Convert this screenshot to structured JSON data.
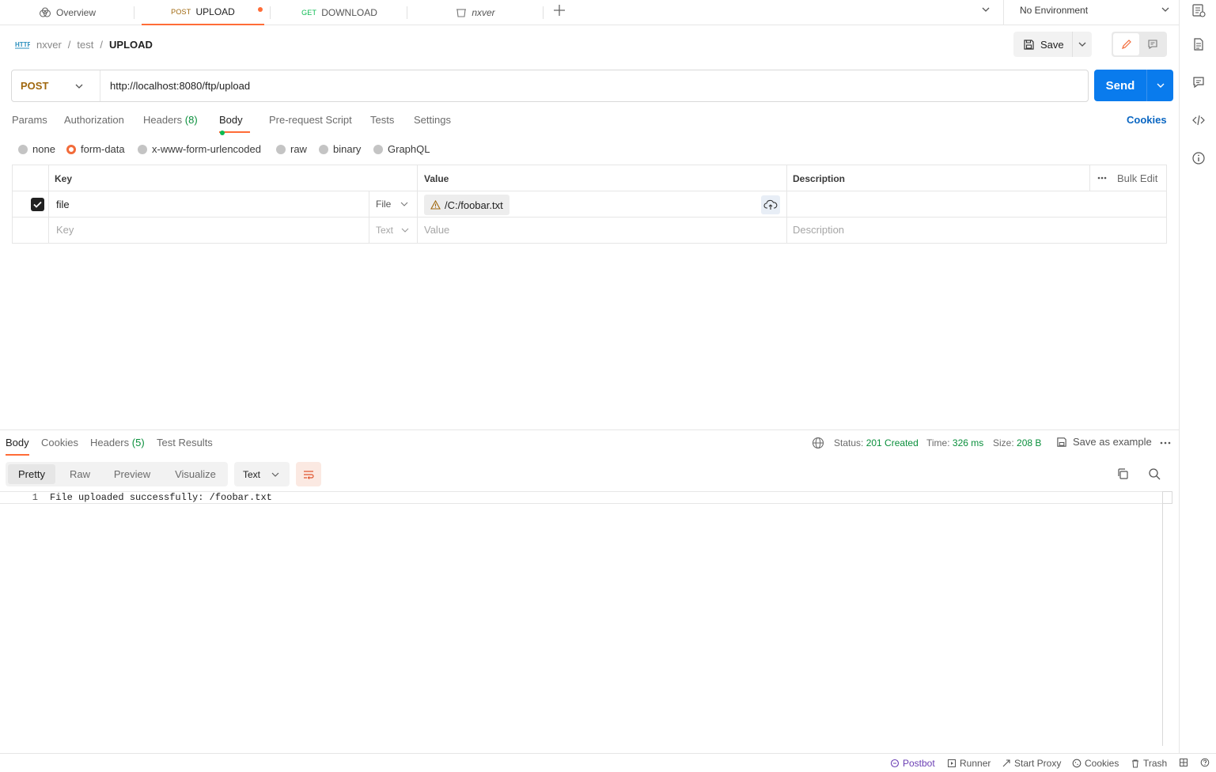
{
  "tabs": {
    "overview": "Overview",
    "upload_method": "POST",
    "upload_name": "UPLOAD",
    "download_method": "GET",
    "download_name": "DOWNLOAD",
    "collection_name": "nxver"
  },
  "environment": "No Environment",
  "breadcrumb": {
    "collection": "nxver",
    "folder": "test",
    "request": "UPLOAD",
    "sep": "/"
  },
  "toolbar": {
    "save_label": "Save"
  },
  "request": {
    "method": "POST",
    "url": "http://localhost:8080/ftp/upload",
    "send_label": "Send"
  },
  "request_tabs": {
    "params": "Params",
    "authorization": "Authorization",
    "headers": "Headers",
    "headers_count": "(8)",
    "body": "Body",
    "prerequest": "Pre-request Script",
    "tests": "Tests",
    "settings": "Settings",
    "cookies": "Cookies"
  },
  "body_types": {
    "none": "none",
    "form_data": "form-data",
    "urlencoded": "x-www-form-urlencoded",
    "raw": "raw",
    "binary": "binary",
    "graphql": "GraphQL",
    "selected": "form-data"
  },
  "form_table": {
    "headers": {
      "key": "Key",
      "value": "Value",
      "description": "Description",
      "bulk_edit": "Bulk Edit"
    },
    "rows": [
      {
        "checked": true,
        "key": "file",
        "type": "File",
        "value": "/C:/foobar.txt",
        "description": ""
      }
    ],
    "placeholder": {
      "key": "Key",
      "type": "Text",
      "value": "Value",
      "description": "Description"
    }
  },
  "response": {
    "tabs": {
      "body": "Body",
      "cookies": "Cookies",
      "headers": "Headers",
      "headers_count": "(5)",
      "test_results": "Test Results"
    },
    "status_label": "Status:",
    "status_value": "201 Created",
    "time_label": "Time:",
    "time_value": "326 ms",
    "size_label": "Size:",
    "size_value": "208 B",
    "save_example": "Save as example",
    "views": {
      "pretty": "Pretty",
      "raw": "Raw",
      "preview": "Preview",
      "visualize": "Visualize"
    },
    "format": "Text",
    "lines": [
      {
        "num": "1",
        "text": "File uploaded successfully: /foobar.txt"
      }
    ]
  },
  "statusbar": {
    "postbot": "Postbot",
    "runner": "Runner",
    "start_proxy": "Start Proxy",
    "cookies": "Cookies",
    "trash": "Trash"
  },
  "colors": {
    "accent": "#ff6c37",
    "send": "#097bed",
    "post": "#a0680f",
    "get": "#0cbb52",
    "success": "#0a8f3c"
  }
}
